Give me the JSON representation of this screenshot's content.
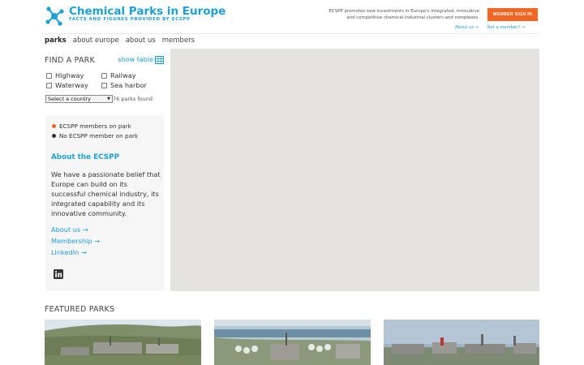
{
  "brand": {
    "title": "Chemical Parks in Europe",
    "subtitle": "FACTS AND FIGURES PROVIDED BY ECSPP",
    "tagline": "ECSPP promotes new investments in Europe's integrated, innovative and competitive chemical industrial clusters and complexes.",
    "member_button": "MEMBER SIGN IN",
    "about_link": "About us →",
    "not_member_link": "Not a member? →",
    "logo_icon": "molecule-icon",
    "accent": "#1ca0d6",
    "button_color": "#f26522"
  },
  "nav": {
    "items": [
      {
        "label": "parks",
        "active": true
      },
      {
        "label": "about europe",
        "active": false
      },
      {
        "label": "about us",
        "active": false
      },
      {
        "label": "members",
        "active": false
      }
    ]
  },
  "finder": {
    "title": "FIND A PARK",
    "show_table": "show table",
    "table_icon": "grid-table-icon",
    "filters": [
      {
        "label": "Highway",
        "checked": false
      },
      {
        "label": "Railway",
        "checked": false
      },
      {
        "label": "Waterway",
        "checked": false
      },
      {
        "label": "Sea harbor",
        "checked": false
      }
    ],
    "country_select": "Select a country",
    "parks_found": "76 parks found"
  },
  "legend": {
    "members": "ECSPP members on park",
    "non_members": "No ECSPP member on park",
    "member_color": "#f26522",
    "non_member_color": "#333333"
  },
  "about": {
    "title": "About the ECSPP",
    "text": "We have a passionate belief that Europe can build on its successful chemical industry, its integrated capability and its innovative community.",
    "links": [
      "About us →",
      "Membership →",
      "LinkedIn →"
    ],
    "social_icon": "linkedin-icon"
  },
  "map": {
    "background": "#e5e3df"
  },
  "featured": {
    "title": "FEATURED PARKS"
  }
}
